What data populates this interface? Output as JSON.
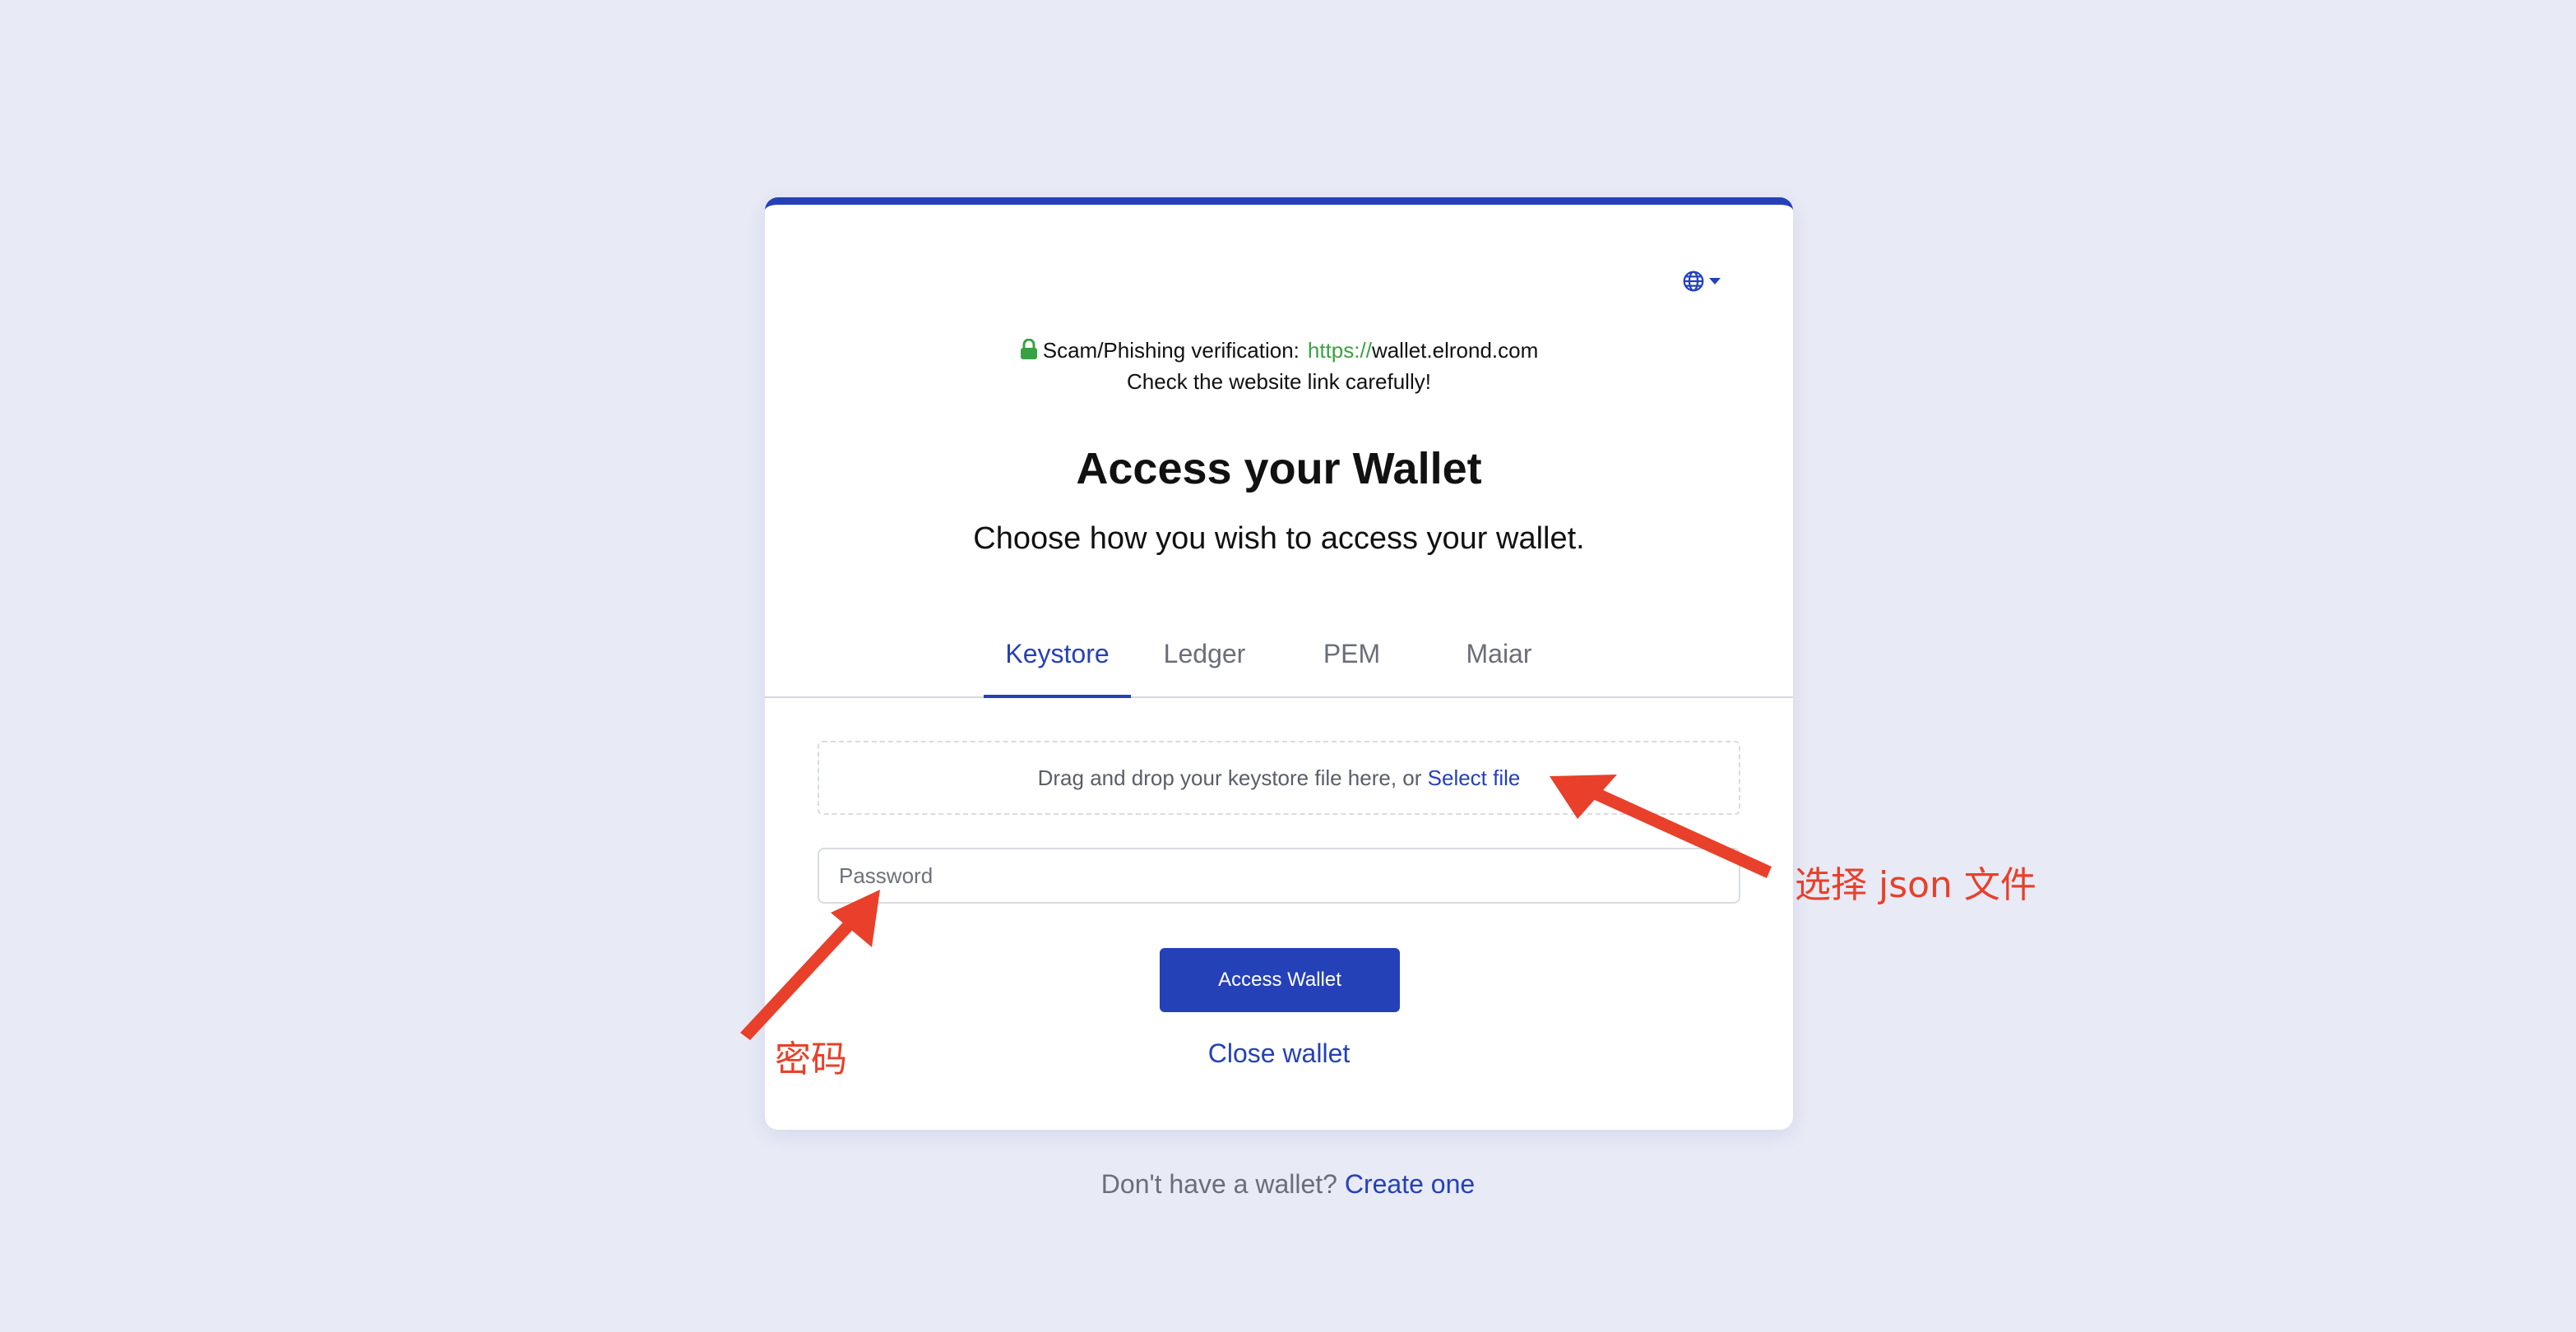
{
  "language_selector": {
    "icon": "globe-icon"
  },
  "verification": {
    "label": "Scam/Phishing verification:",
    "protocol": "https://",
    "domain": "wallet.elrond.com",
    "warning": "Check the website link carefully!",
    "icon": "lock-icon"
  },
  "heading": {
    "title": "Access your Wallet",
    "subtitle": "Choose how you wish to access your wallet."
  },
  "tabs": [
    {
      "label": "Keystore",
      "active": true
    },
    {
      "label": "Ledger",
      "active": false
    },
    {
      "label": "PEM",
      "active": false
    },
    {
      "label": "Maiar",
      "active": false
    }
  ],
  "keystore": {
    "dropzone_text": "Drag and drop your keystore file here, or",
    "select_file": "Select file",
    "password_placeholder": "Password",
    "password_value": ""
  },
  "actions": {
    "access_wallet": "Access Wallet",
    "close_wallet": "Close wallet"
  },
  "footer": {
    "prompt": "Don't have a wallet?",
    "create_link": "Create one"
  },
  "annotations": {
    "select_json": "选择 json 文件",
    "password": "密码"
  },
  "colors": {
    "accent": "#2541b8",
    "background": "#e8eaf5",
    "annotation": "#e8402a",
    "https_green": "#3aa142"
  }
}
